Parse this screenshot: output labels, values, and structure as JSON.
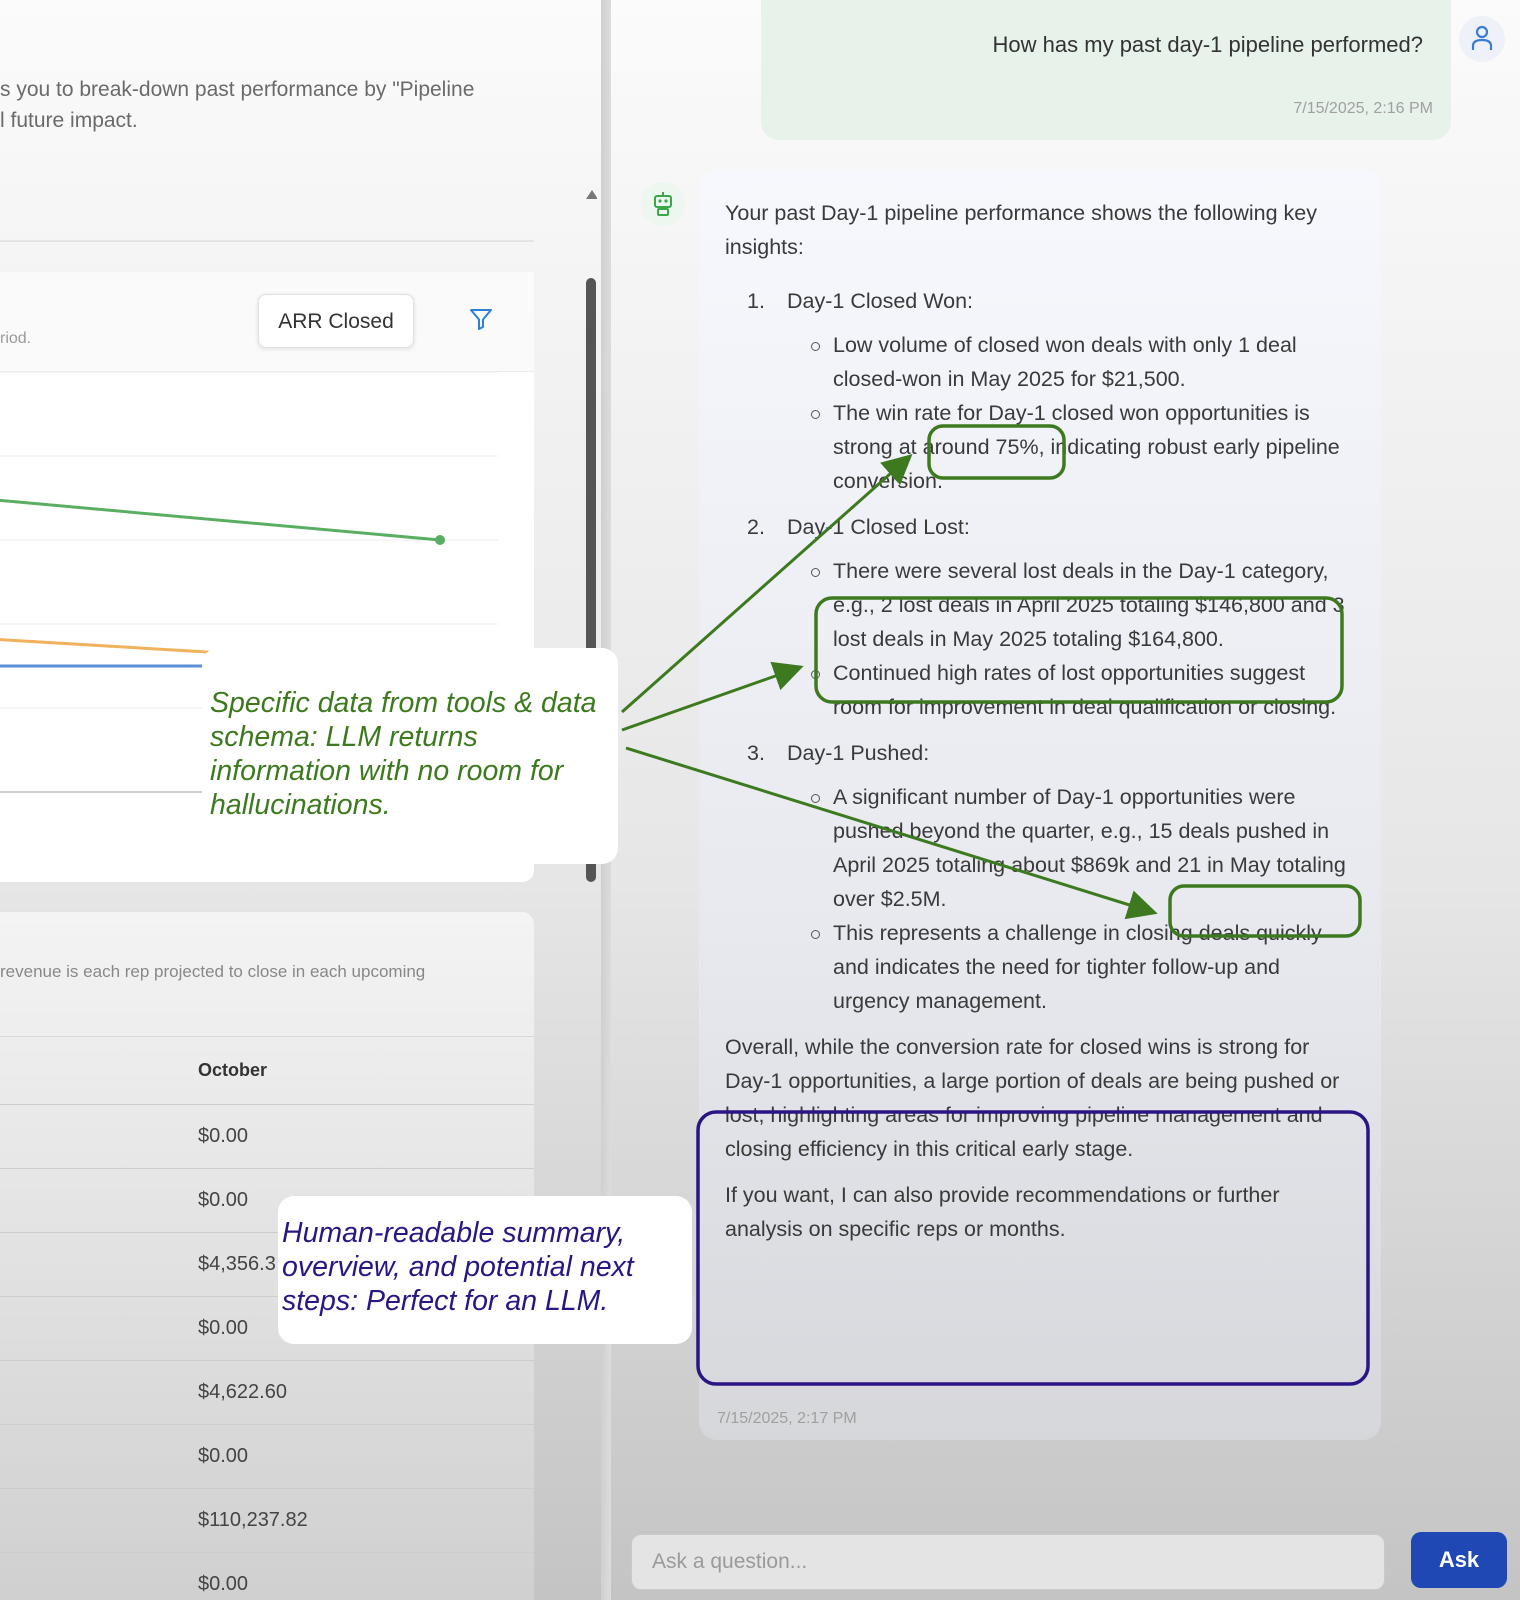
{
  "dashboard": {
    "intro_line1": "s you to break-down past performance by \"Pipeline",
    "intro_line2": "l future impact.",
    "chart_card": {
      "description": "riod.",
      "metric_label": "ARR Closed",
      "filter_icon": "filter-icon"
    },
    "table_card": {
      "description": "revenue is each rep projected to close in each upcoming",
      "column_header": "October",
      "rows": [
        "$0.00",
        "$0.00",
        "$4,356.3",
        "$0.00",
        "$4,622.60",
        "$0.00",
        "$110,237.82",
        "$0.00"
      ]
    }
  },
  "chart_data": {
    "type": "line",
    "series": [
      {
        "color": "#5aae62",
        "values": [
          78,
          60
        ]
      },
      {
        "color": "#5b8fd8",
        "values": [
          30,
          30
        ]
      },
      {
        "color": "#f0b25a",
        "values": [
          42,
          30
        ]
      }
    ],
    "grid": true,
    "legend": "none"
  },
  "chat": {
    "user_message": "How has my past day-1 pipeline performed?",
    "user_time": "7/15/2025, 2:16 PM",
    "bot": {
      "intro": "Your past Day-1 pipeline performance shows the following key insights:",
      "insights": [
        {
          "num": "1.",
          "title": "Day-1 Closed Won:",
          "bullets": [
            "Low volume of closed won deals with only 1 deal closed-won in May 2025 for $21,500.",
            "The win rate for Day-1 closed won opportunities is strong at around 75%, indicating robust early pipeline conversion."
          ]
        },
        {
          "num": "2.",
          "title": "Day-1 Closed Lost:",
          "bullets": [
            "There were several lost deals in the Day-1 category, e.g., 2 lost deals in April 2025 totaling $146,800 and 3 lost deals in May 2025 totaling $164,800.",
            "Continued high rates of lost opportunities suggest room for improvement in deal qualification or closing."
          ]
        },
        {
          "num": "3.",
          "title": "Day-1 Pushed:",
          "bullets": [
            "A significant number of Day-1 opportunities were pushed beyond the quarter, e.g., 15 deals pushed in April 2025 totaling about $869k and 21 in May totaling over $2.5M.",
            "This represents a challenge in closing deals quickly and indicates the need for tighter follow-up and urgency management."
          ]
        }
      ],
      "summary_1": "Overall, while the conversion rate for closed wins is strong for Day-1 opportunities, a large portion of deals are being pushed or lost, highlighting areas for improving pipeline management and closing efficiency in this critical early stage.",
      "summary_2": "If you want, I can also provide recommendations or further analysis on specific reps or months.",
      "time": "7/15/2025, 2:17 PM"
    },
    "input_placeholder": "Ask a question...",
    "ask_label": "Ask"
  },
  "annotations": {
    "data_note": "Specific data from tools & data schema: LLM returns information with no room for hallucinations.",
    "summary_note": "Human-readable summary, overview, and potential next steps: Perfect for an LLM.",
    "green_color": "#3d7a1f",
    "purple_color": "#2a1585"
  }
}
